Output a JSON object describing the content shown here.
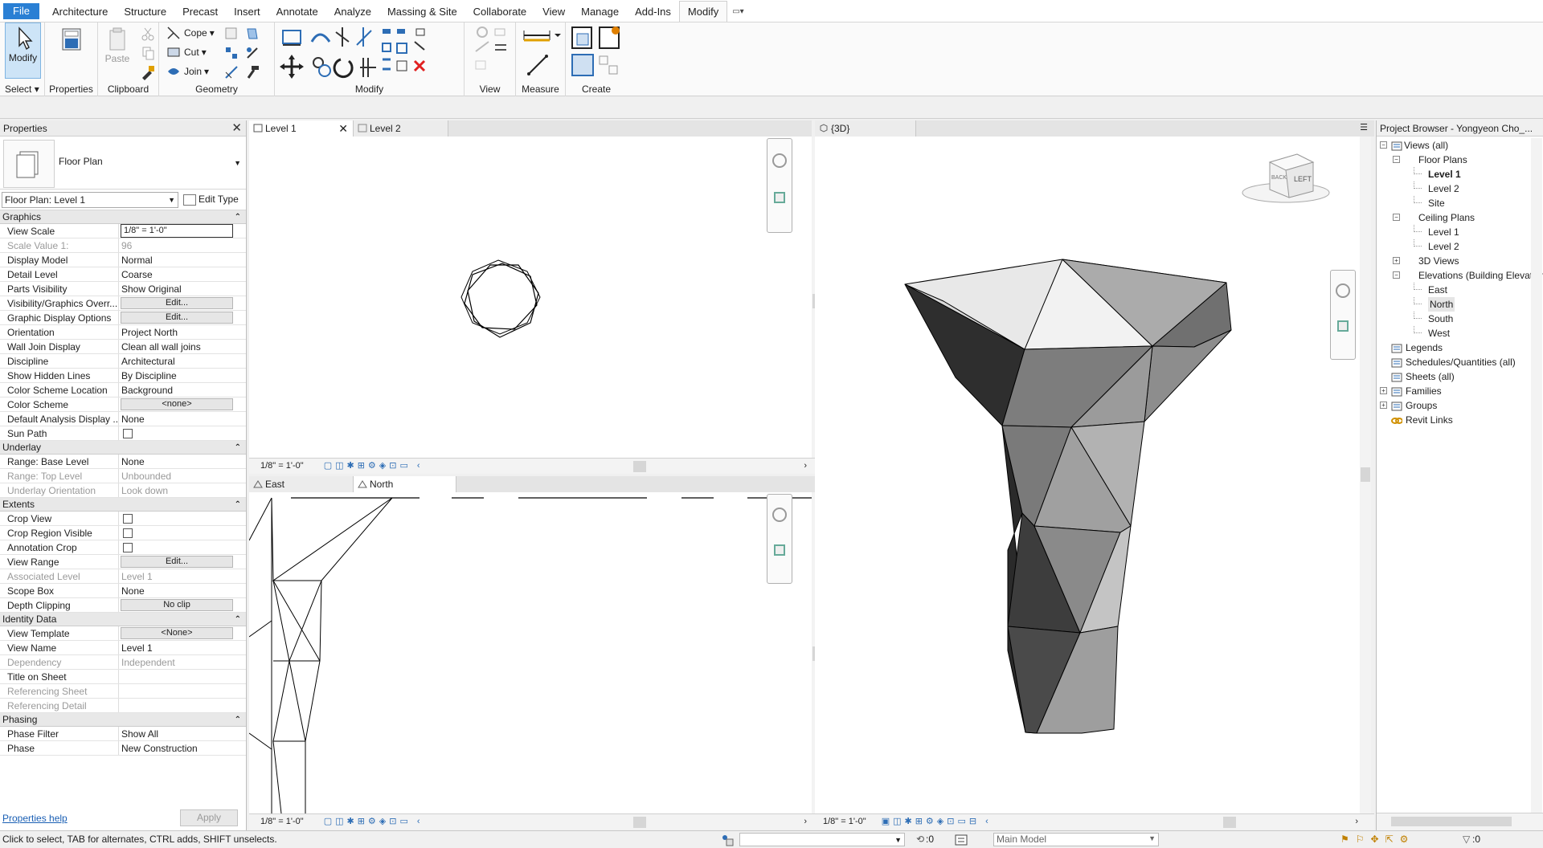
{
  "ribbon": {
    "tabs": [
      "File",
      "Architecture",
      "Structure",
      "Precast",
      "Insert",
      "Annotate",
      "Analyze",
      "Massing & Site",
      "Collaborate",
      "View",
      "Manage",
      "Add-Ins",
      "Modify"
    ],
    "active_tab": "Modify",
    "groups": {
      "select": "Select",
      "properties": "Properties",
      "clipboard": "Clipboard",
      "geometry": "Geometry",
      "modify": "Modify",
      "view": "View",
      "measure": "Measure",
      "create": "Create"
    },
    "modify_label": "Modify",
    "properties_label": "Properties",
    "paste_label": "Paste",
    "cope_label": "Cope",
    "cut_label": "Cut",
    "join_label": "Join"
  },
  "properties": {
    "title": "Properties",
    "type_name": "Floor Plan",
    "instance_selector": "Floor Plan: Level 1",
    "edit_type": "Edit Type",
    "categories": [
      {
        "name": "Graphics",
        "rows": [
          {
            "n": "View Scale",
            "v": "1/8\" = 1'-0\"",
            "k": "input"
          },
          {
            "n": "Scale Value    1:",
            "v": "96",
            "k": "gray"
          },
          {
            "n": "Display Model",
            "v": "Normal"
          },
          {
            "n": "Detail Level",
            "v": "Coarse"
          },
          {
            "n": "Parts Visibility",
            "v": "Show Original"
          },
          {
            "n": "Visibility/Graphics Overr...",
            "v": "Edit...",
            "k": "btn"
          },
          {
            "n": "Graphic Display Options",
            "v": "Edit...",
            "k": "btn"
          },
          {
            "n": "Orientation",
            "v": "Project North"
          },
          {
            "n": "Wall Join Display",
            "v": "Clean all wall joins"
          },
          {
            "n": "Discipline",
            "v": "Architectural"
          },
          {
            "n": "Show Hidden Lines",
            "v": "By Discipline"
          },
          {
            "n": "Color Scheme Location",
            "v": "Background"
          },
          {
            "n": "Color Scheme",
            "v": "<none>",
            "k": "btn"
          },
          {
            "n": "Default Analysis Display ...",
            "v": "None"
          },
          {
            "n": "Sun Path",
            "v": "",
            "k": "chk"
          }
        ]
      },
      {
        "name": "Underlay",
        "rows": [
          {
            "n": "Range: Base Level",
            "v": "None"
          },
          {
            "n": "Range: Top Level",
            "v": "Unbounded",
            "k": "gray"
          },
          {
            "n": "Underlay Orientation",
            "v": "Look down",
            "k": "gray"
          }
        ]
      },
      {
        "name": "Extents",
        "rows": [
          {
            "n": "Crop View",
            "v": "",
            "k": "chk"
          },
          {
            "n": "Crop Region Visible",
            "v": "",
            "k": "chk"
          },
          {
            "n": "Annotation Crop",
            "v": "",
            "k": "chk"
          },
          {
            "n": "View Range",
            "v": "Edit...",
            "k": "btn"
          },
          {
            "n": "Associated Level",
            "v": "Level 1",
            "k": "gray"
          },
          {
            "n": "Scope Box",
            "v": "None"
          },
          {
            "n": "Depth Clipping",
            "v": "No clip",
            "k": "btn"
          }
        ]
      },
      {
        "name": "Identity Data",
        "rows": [
          {
            "n": "View Template",
            "v": "<None>",
            "k": "btn"
          },
          {
            "n": "View Name",
            "v": "Level 1"
          },
          {
            "n": "Dependency",
            "v": "Independent",
            "k": "gray"
          },
          {
            "n": "Title on Sheet",
            "v": ""
          },
          {
            "n": "Referencing Sheet",
            "v": "",
            "k": "gray"
          },
          {
            "n": "Referencing Detail",
            "v": "",
            "k": "gray"
          }
        ]
      },
      {
        "name": "Phasing",
        "rows": [
          {
            "n": "Phase Filter",
            "v": "Show All"
          },
          {
            "n": "Phase",
            "v": "New Construction"
          }
        ]
      }
    ],
    "help_link": "Properties help",
    "apply": "Apply"
  },
  "views": {
    "tab_level1": "Level 1",
    "tab_level2": "Level 2",
    "tab_3d": "{3D}",
    "tab_east": "East",
    "tab_north": "North",
    "scale": "1/8\" = 1'-0\"",
    "viewcube_left": "LEFT",
    "viewcube_back": "BACK"
  },
  "browser": {
    "title": "Project Browser - Yongyeon Cho_...",
    "items": [
      {
        "label": "Views (all)",
        "depth": 0,
        "ex": "-"
      },
      {
        "label": "Floor Plans",
        "depth": 1,
        "ex": "-"
      },
      {
        "label": "Level 1",
        "depth": 2,
        "bold": true
      },
      {
        "label": "Level 2",
        "depth": 2
      },
      {
        "label": "Site",
        "depth": 2
      },
      {
        "label": "Ceiling Plans",
        "depth": 1,
        "ex": "-"
      },
      {
        "label": "Level 1",
        "depth": 2
      },
      {
        "label": "Level 2",
        "depth": 2
      },
      {
        "label": "3D Views",
        "depth": 1,
        "ex": "+"
      },
      {
        "label": "Elevations (Building Elevation",
        "depth": 1,
        "ex": "-"
      },
      {
        "label": "East",
        "depth": 2
      },
      {
        "label": "North",
        "depth": 2,
        "sel": true
      },
      {
        "label": "South",
        "depth": 2
      },
      {
        "label": "West",
        "depth": 2
      },
      {
        "label": "Legends",
        "depth": 0,
        "icon": true
      },
      {
        "label": "Schedules/Quantities (all)",
        "depth": 0,
        "icon": true
      },
      {
        "label": "Sheets (all)",
        "depth": 0,
        "icon": true
      },
      {
        "label": "Families",
        "depth": 0,
        "ex": "+",
        "icon": true
      },
      {
        "label": "Groups",
        "depth": 0,
        "ex": "+",
        "icon": true
      },
      {
        "label": "Revit Links",
        "depth": 0,
        "icon": true,
        "link": true
      }
    ]
  },
  "status": {
    "message": "Click to select, TAB for alternates, CTRL adds, SHIFT unselects.",
    "count": ":0",
    "model": "Main Model",
    "filter_count": ":0"
  }
}
